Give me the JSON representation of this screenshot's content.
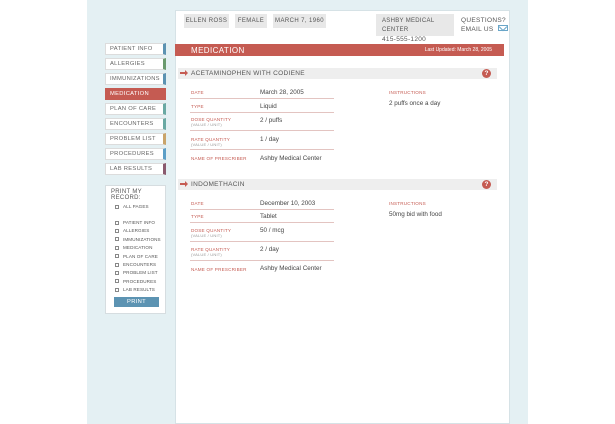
{
  "patient": {
    "name": "Ellen Ross",
    "gender": "Female",
    "dob": "March 7, 1960"
  },
  "provider": {
    "name": "Ashby Medical Center",
    "phone": "415-555-1200"
  },
  "questions": {
    "label": "Questions?",
    "email_label": "Email us"
  },
  "nav": {
    "items": [
      {
        "label": "Patient Info",
        "color": "#5c93b2"
      },
      {
        "label": "Allergies",
        "color": "#6a9a6e"
      },
      {
        "label": "Immunizations",
        "color": "#5c93b2"
      },
      {
        "label": "Medication",
        "color": "#c55b52"
      },
      {
        "label": "Plan of Care",
        "color": "#6aa9a3"
      },
      {
        "label": "Encounters",
        "color": "#6aa9a3"
      },
      {
        "label": "Problem List",
        "color": "#c9a46a"
      },
      {
        "label": "Procedures",
        "color": "#5c9fc7"
      },
      {
        "label": "Lab Results",
        "color": "#8a5a6e"
      }
    ]
  },
  "print": {
    "title": "Print my record:",
    "all_pages": "All Pages",
    "options": [
      "Patient Info",
      "Allergies",
      "Immunizations",
      "Medication",
      "Plan of Care",
      "Encounters",
      "Problem List",
      "Procedures",
      "Lab Results"
    ],
    "button": "Print"
  },
  "section": {
    "title": "Medication",
    "last_updated": "Last Updated: March 28, 2005"
  },
  "labels": {
    "date": "Date",
    "type": "Type",
    "dose": "Dose Quantity",
    "dose_sub": "(Value / Unit)",
    "rate": "Rate Quantity",
    "rate_sub": "(Value / Unit)",
    "prescriber": "Name of Prescriber",
    "instructions": "Instructions"
  },
  "medications": [
    {
      "name": "Acetaminophen with Codiene",
      "date": "March 28, 2005",
      "type": "Liquid",
      "dose": "2 / puffs",
      "rate": "1 / day",
      "prescriber": "Ashby Medical Center",
      "instructions": "2 puffs once a day"
    },
    {
      "name": "Indomethacin",
      "date": "December 10, 2003",
      "type": "Tablet",
      "dose": "50 / mcg",
      "rate": "2 / day",
      "prescriber": "Ashby Medical Center",
      "instructions": "50mg bid with food"
    }
  ]
}
